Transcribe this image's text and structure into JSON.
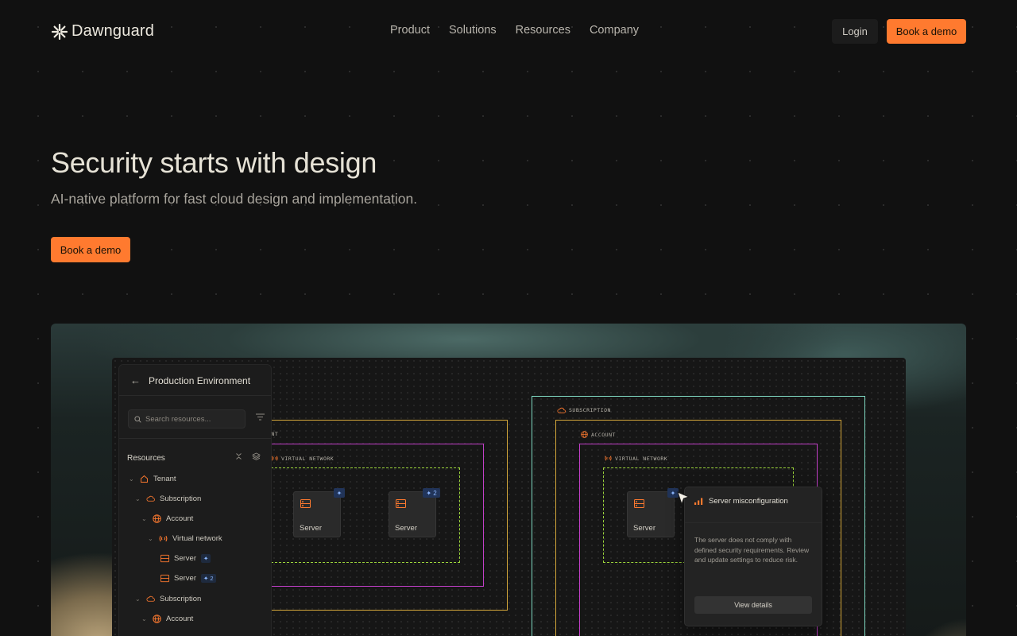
{
  "brand": {
    "name": "Dawnguard",
    "logo_icon": "asterisk-logo-icon"
  },
  "nav": {
    "links": [
      "Product",
      "Solutions",
      "Resources",
      "Company"
    ],
    "login_label": "Login",
    "demo_label": "Book a demo"
  },
  "hero": {
    "title": "Security starts with design",
    "subtitle": "AI-native platform for fast cloud design and implementation.",
    "cta_label": "Book a demo"
  },
  "colors": {
    "accent": "#ff7a2f",
    "background": "#111111",
    "subscription_border": "#7fd8c2",
    "account_border": "#d4a73a",
    "vnet_border": "#c23fc8",
    "subnet_border": "#9bd43a",
    "badge_blue": "#8db8ff"
  },
  "panel": {
    "title": "Production Environment",
    "search_placeholder": "Search resources...",
    "resources_label": "Resources",
    "tree": [
      {
        "label": "Tenant",
        "icon": "home-icon"
      },
      {
        "label": "Subscription",
        "icon": "cloud-icon"
      },
      {
        "label": "Account",
        "icon": "globe-icon"
      },
      {
        "label": "Virtual network",
        "icon": "signal-icon"
      },
      {
        "label": "Server",
        "icon": "server-icon",
        "badge": "✦"
      },
      {
        "label": "Server",
        "icon": "server-icon",
        "badge": "✦ 2"
      },
      {
        "label": "Subscription",
        "icon": "cloud-icon"
      },
      {
        "label": "Account",
        "icon": "globe-icon"
      }
    ]
  },
  "diagram": {
    "left_account_label": "UNT",
    "subscription_label": "SUBSCRIPTION",
    "account_label": "ACCOUNT",
    "vnet_label": "VIRTUAL NETWORK",
    "server_label": "Server",
    "badge_single": "✦",
    "badge_double": "✦ 2"
  },
  "popover": {
    "title": "Server misconfiguration",
    "body": "The server does not comply with defined security requirements. Review and update settings to reduce risk.",
    "button": "View details"
  }
}
